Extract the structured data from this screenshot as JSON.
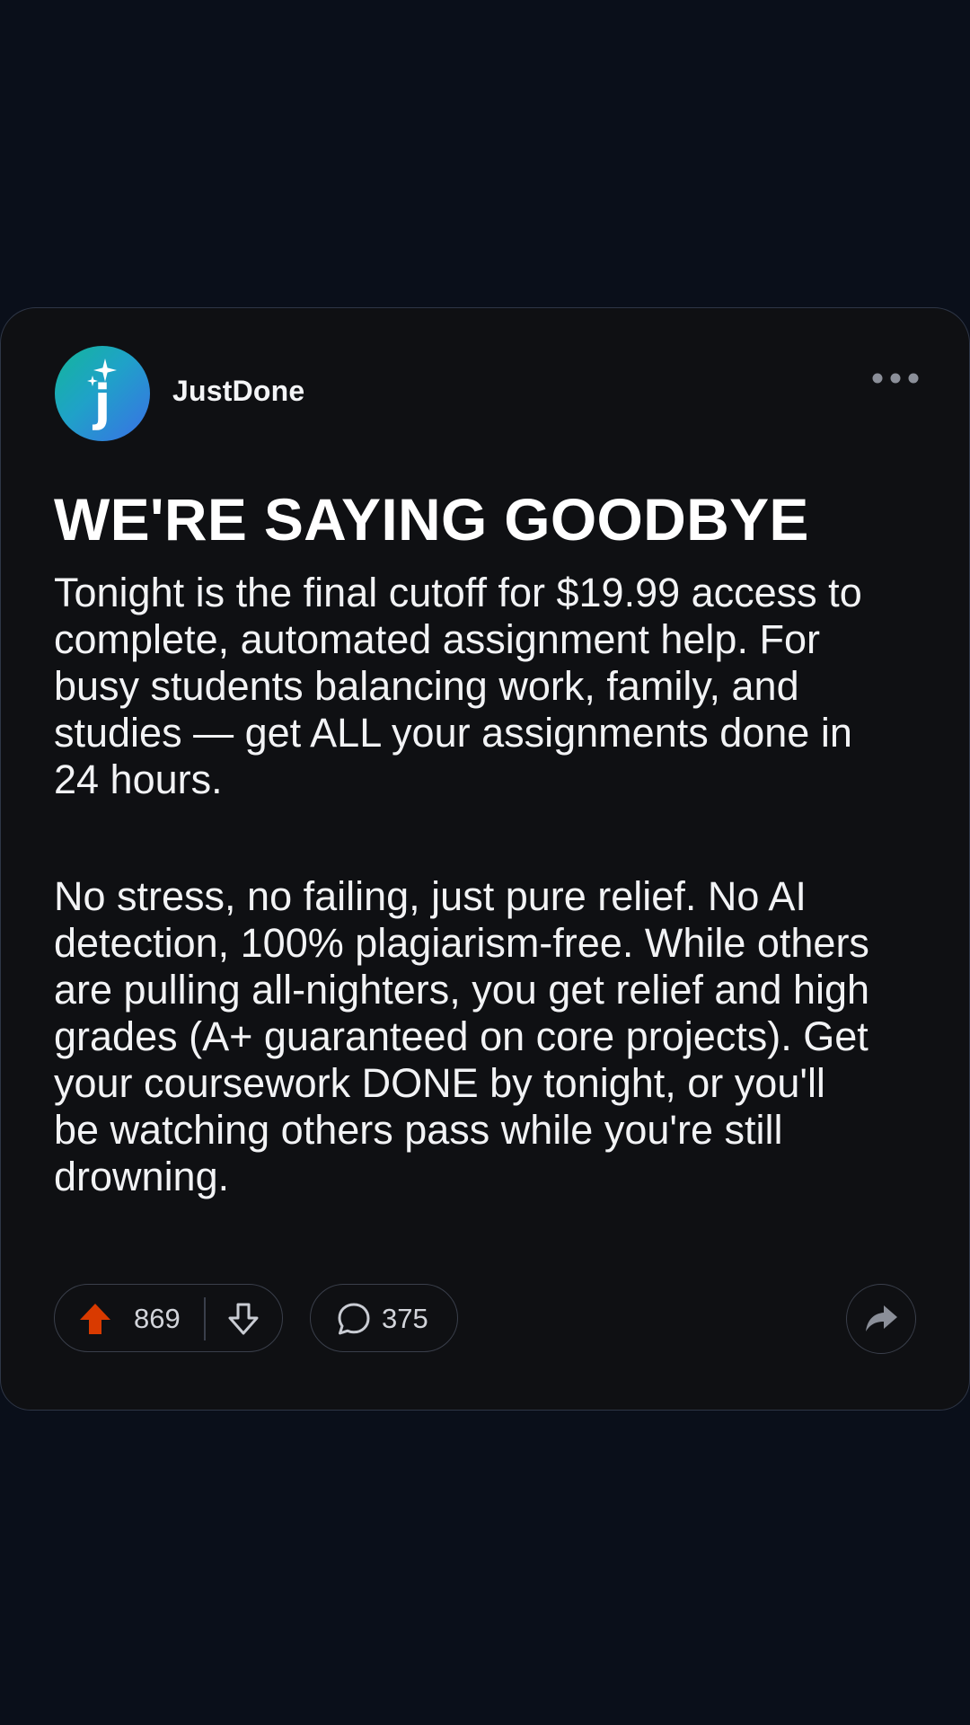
{
  "post": {
    "author": "JustDone",
    "avatar_letter": "j",
    "avatar_icon": "sparkle-icon",
    "menu_icon": "more-horizontal-icon",
    "headline": "WE'RE SAYING GOODBYE",
    "paragraphs": [
      "Tonight is the final cutoff for $19.99 access to complete, automated assignment help. For busy students balancing work, family, and studies — get ALL your assignments done in 24 hours.",
      "No stress, no failing, just pure relief. No AI detection, 100% plagiarism-free. While others are pulling all-nighters, you get relief and high grades (A+ guaranteed on core projects). Get your coursework DONE by tonight, or you'll be watching others pass while you're still drowning."
    ]
  },
  "actions": {
    "upvote_count": "869",
    "comment_count": "375",
    "upvote_icon": "upvote-arrow-icon",
    "downvote_icon": "downvote-arrow-icon",
    "comment_icon": "comment-bubble-icon",
    "share_icon": "share-arrow-icon"
  },
  "colors": {
    "page_background": "#0a0f1a",
    "card_background": "#0f1013",
    "upvote_active": "#d93a00",
    "avatar_gradient_start": "#13b69a",
    "avatar_gradient_end": "#3a6fe6"
  }
}
